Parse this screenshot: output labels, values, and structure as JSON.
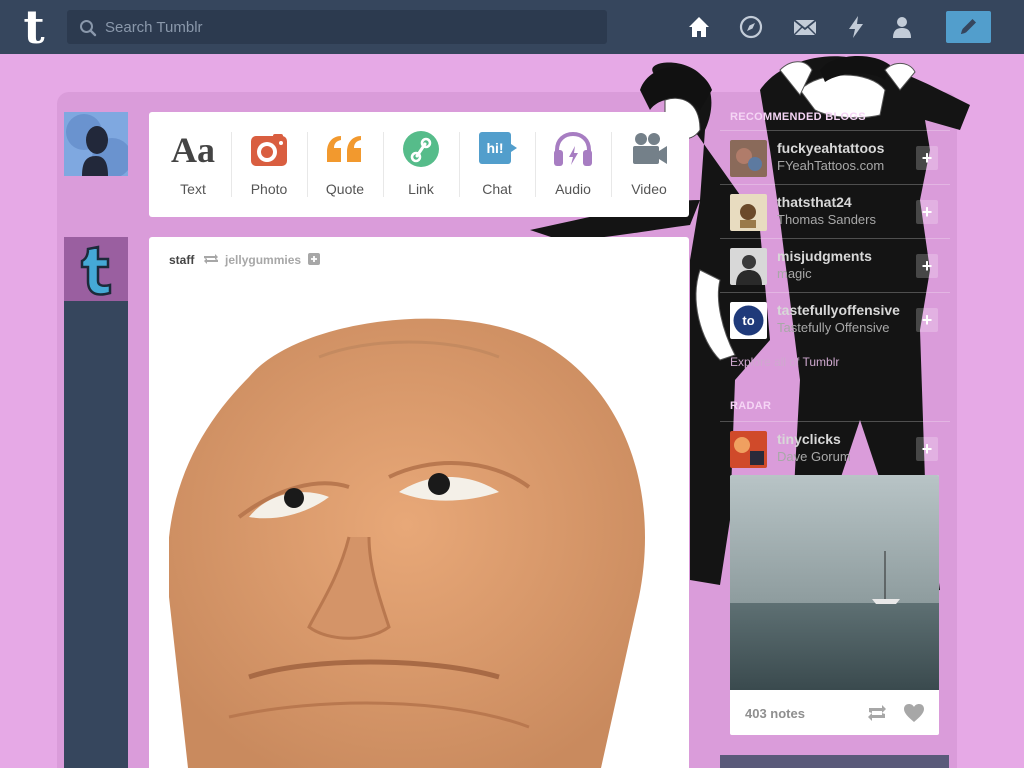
{
  "app": {
    "logo_letter": "t",
    "accent_color": "#529ecc",
    "nav_bg": "#36465d",
    "page_bg": "#e6a9e6"
  },
  "header": {
    "search_placeholder": "Search Tumblr",
    "nav_icons": [
      "home-icon",
      "explore-compass-icon",
      "inbox-mail-icon",
      "activity-lightning-icon",
      "account-person-icon"
    ],
    "compose_icon": "pencil-icon"
  },
  "post_types": [
    {
      "label": "Text",
      "icon": "Aa",
      "color": "#444444"
    },
    {
      "label": "Photo",
      "icon": "camera-icon",
      "color": "#d95e40"
    },
    {
      "label": "Quote",
      "icon": "quote-icon",
      "color": "#f2992e"
    },
    {
      "label": "Link",
      "icon": "link-icon",
      "color": "#56bc8a"
    },
    {
      "label": "Chat",
      "icon": "chat-bubble-icon",
      "color": "#529ecc"
    },
    {
      "label": "Audio",
      "icon": "headphones-icon",
      "color": "#a77dc2"
    },
    {
      "label": "Video",
      "icon": "video-camera-icon",
      "color": "#748089"
    }
  ],
  "post": {
    "author": "staff",
    "reblogged_from": "jellygummies",
    "avatar_letter": "t"
  },
  "sidebar": {
    "recommended_title": "Recommended Blogs",
    "recommended": [
      {
        "name": "fuckyeahtattoos",
        "subtitle": "FYeahTattoos.com"
      },
      {
        "name": "thatsthat24",
        "subtitle": "Thomas Sanders"
      },
      {
        "name": "misjudgments",
        "subtitle": "magic"
      },
      {
        "name": "tastefullyoffensive",
        "subtitle": "Tastefully Offensive"
      }
    ],
    "follow_label": "+",
    "explore_link": "Explore all of Tumblr",
    "radar_title": "Radar",
    "radar": {
      "name": "tinyclicks",
      "subtitle": "Dave Gorum",
      "notes": "403 notes"
    },
    "tastefully_badge": "to"
  }
}
